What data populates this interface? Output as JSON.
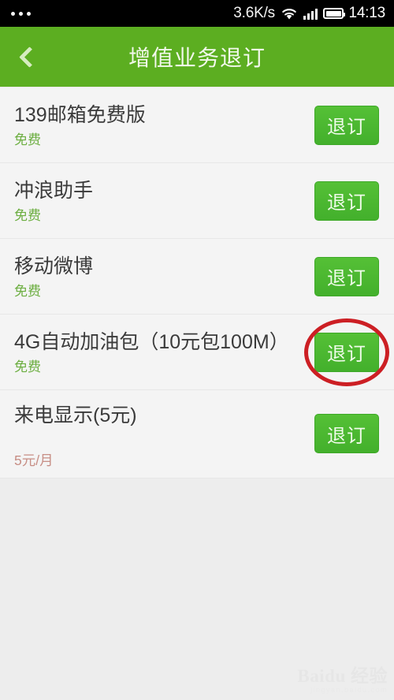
{
  "status_bar": {
    "notification_icon": "three-dots-icon",
    "network_speed": "3.6K/s",
    "wifi_icon": "wifi-icon",
    "signal_icon": "cellular-signal-icon",
    "battery_icon": "battery-icon",
    "time": "14:13",
    "background": "#000000"
  },
  "header": {
    "back_icon": "chevron-left-icon",
    "title": "增值业务退订",
    "background": "#5cae21",
    "title_color": "#f2f8ec"
  },
  "list": {
    "items": [
      {
        "title": "139邮箱免费版",
        "price": "免费",
        "price_type": "free",
        "button_label": "退订",
        "annotated": false
      },
      {
        "title": "冲浪助手",
        "price": "免费",
        "price_type": "free",
        "button_label": "退订",
        "annotated": false
      },
      {
        "title": "移动微博",
        "price": "免费",
        "price_type": "free",
        "button_label": "退订",
        "annotated": false
      },
      {
        "title": "4G自动加油包（10元包100M）",
        "price": "免费",
        "price_type": "free",
        "button_label": "退订",
        "annotated": true
      },
      {
        "title": "来电显示(5元)",
        "price": "5元/月",
        "price_type": "paid",
        "button_label": "退订",
        "annotated": false
      }
    ],
    "button_color": "#4dbb33",
    "free_color": "#6cae41",
    "paid_color": "#c78e85",
    "row_background": "#f4f4f4"
  },
  "annotation": {
    "shape": "red-ellipse-highlight",
    "color": "#cc1f24",
    "target": "退订"
  },
  "watermark": {
    "main": "Baidu 经验",
    "sub": "jingyan.baidu.com"
  }
}
